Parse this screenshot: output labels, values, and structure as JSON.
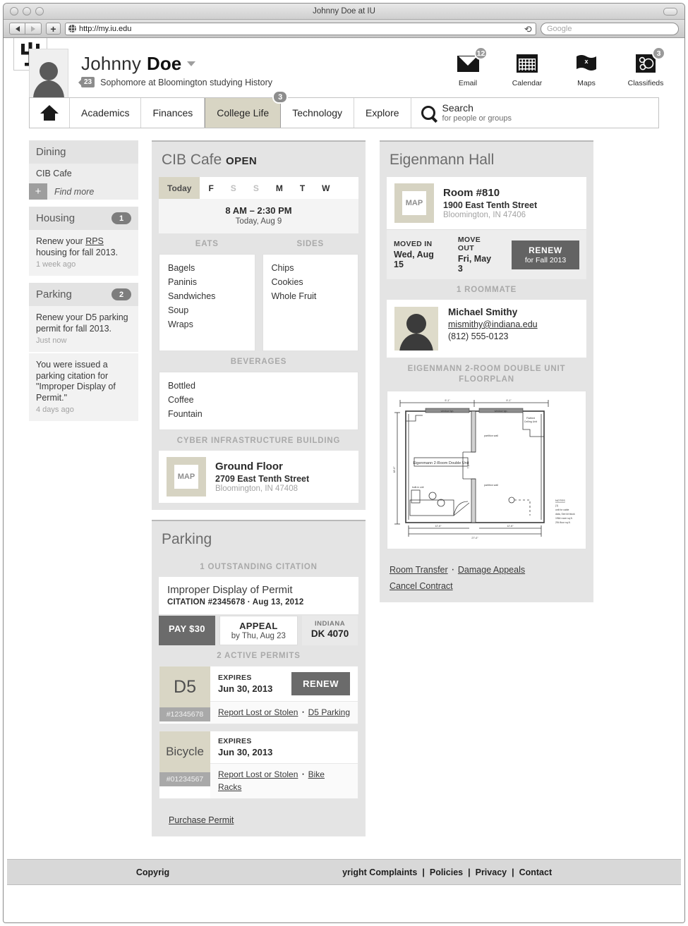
{
  "browser": {
    "window_title": "Johnny Doe at IU",
    "url": "http://my.iu.edu",
    "search_placeholder": "Google",
    "reload_icon": "reload-icon",
    "back_icon": "back-arrow-icon",
    "forward_icon": "forward-arrow-icon",
    "add_tab_icon": "plus-icon"
  },
  "header": {
    "logo": "iu-trident-logo",
    "avatar": "user-avatar",
    "first_name": "Johnny",
    "last_name": "Doe",
    "dropdown_icon": "chevron-down-icon",
    "notif_count": "23",
    "subtitle": "Sophomore at Bloomington studying History",
    "utilities": [
      {
        "label": "Email",
        "count": "12",
        "icon": "envelope-icon"
      },
      {
        "label": "Calendar",
        "count": "",
        "icon": "calendar-icon"
      },
      {
        "label": "Maps",
        "count": "",
        "icon": "map-flag-icon"
      },
      {
        "label": "Classifieds",
        "count": "3",
        "icon": "classifieds-icon"
      }
    ]
  },
  "nav": {
    "home_icon": "home-icon",
    "items": [
      {
        "label": "Academics",
        "badge": ""
      },
      {
        "label": "Finances",
        "badge": ""
      },
      {
        "label": "College Life",
        "badge": "3"
      },
      {
        "label": "Technology",
        "badge": ""
      },
      {
        "label": "Explore",
        "badge": ""
      }
    ],
    "search": {
      "icon": "search-icon",
      "title": "Search",
      "subtitle": "for people or groups"
    }
  },
  "sidebar": {
    "dining": {
      "title": "Dining",
      "badge": "",
      "items": [
        "CIB Cafe"
      ],
      "find_more": "Find more",
      "plus_icon": "plus-icon"
    },
    "housing": {
      "title": "Housing",
      "badge": "1",
      "notifications": [
        {
          "text_before": "Renew your ",
          "link": "RPS",
          "text_after": " housing for fall 2013.",
          "time": "1 week ago"
        }
      ]
    },
    "parking": {
      "title": "Parking",
      "badge": "2",
      "notifications": [
        {
          "text": "Renew your D5 parking permit for fall 2013.",
          "time": "Just now"
        },
        {
          "text": "You were issued a parking citation for \"Improper Display of Permit.\"",
          "time": "4 days ago"
        }
      ]
    }
  },
  "cafe": {
    "title": "CIB Cafe",
    "status": "OPEN",
    "days": [
      {
        "label": "Today",
        "selected": true,
        "dim": false
      },
      {
        "label": "F",
        "selected": false,
        "dim": false
      },
      {
        "label": "S",
        "selected": false,
        "dim": true
      },
      {
        "label": "S",
        "selected": false,
        "dim": true
      },
      {
        "label": "M",
        "selected": false,
        "dim": false
      },
      {
        "label": "T",
        "selected": false,
        "dim": false
      },
      {
        "label": "W",
        "selected": false,
        "dim": false
      }
    ],
    "hours": "8 AM – 2:30 PM",
    "hours_date": "Today, Aug 9",
    "menu": [
      {
        "heading": "EATS",
        "items": [
          "Bagels",
          "Paninis",
          "Sandwiches",
          "Soup",
          "Wraps"
        ]
      },
      {
        "heading": "SIDES",
        "items": [
          "Chips",
          "Cookies",
          "Whole Fruit"
        ]
      }
    ],
    "beverages": {
      "heading": "BEVERAGES",
      "items": [
        "Bottled",
        "Coffee",
        "Fountain"
      ]
    },
    "location": {
      "heading": "CYBER INFRASTRUCTURE BUILDING",
      "map_label": "MAP",
      "name": "Ground Floor",
      "street": "2709 East Tenth Street",
      "city": "Bloomington, IN 47408"
    }
  },
  "parking_panel": {
    "title": "Parking",
    "citation_heading": "1 OUTSTANDING CITATION",
    "citation": {
      "name": "Improper Display of Permit",
      "meta": "CITATION #2345678 · Aug 13, 2012",
      "pay_label": "PAY",
      "pay_amount": "$30",
      "appeal_label": "APPEAL",
      "appeal_due": "by Thu, Aug 23",
      "plate_state": "INDIANA",
      "plate_number": "DK 4070"
    },
    "permits_heading": "2 ACTIVE PERMITS",
    "permits": [
      {
        "tag": "D5",
        "number": "#12345678",
        "expires_label": "EXPIRES",
        "expires": "Jun 30, 2013",
        "renew_label": "RENEW",
        "links": [
          "Report Lost or Stolen",
          "D5 Parking"
        ]
      },
      {
        "tag": "Bicycle",
        "number": "#01234567",
        "expires_label": "EXPIRES",
        "expires": "Jun 30, 2013",
        "renew_label": "",
        "links": [
          "Report Lost or Stolen",
          "Bike Racks"
        ]
      }
    ],
    "purchase_link": "Purchase Permit"
  },
  "housing_panel": {
    "title": "Eigenmann Hall",
    "room": {
      "map_label": "MAP",
      "name": "Room #810",
      "street": "1900 East Tenth Street",
      "city": "Bloomington, IN 47406"
    },
    "moved_in_label": "MOVED IN",
    "moved_in": "Wed, Aug 15",
    "move_out_label": "MOVE OUT",
    "move_out": "Fri, May 3",
    "renew_label": "RENEW",
    "renew_sub": "for Fall 2013",
    "roommate_heading": "1 ROOMMATE",
    "roommate": {
      "avatar": "roommate-avatar",
      "name": "Michael Smithy",
      "email": "mismithy@indiana.edu",
      "phone": "(812) 555-0123"
    },
    "floorplan_heading": "EIGENMANN 2-ROOM DOUBLE UNIT FLOORPLAN",
    "floorplan_alt": "floorplan-drawing",
    "floorplan_room_label": "Eigenmann 2-Room Double Unit",
    "links": [
      "Room Transfer",
      "Damage Appeals",
      "Cancel Contract"
    ]
  },
  "footer": {
    "left_text": "Copyrig",
    "right_text": "yright Complaints",
    "links": [
      "Policies",
      "Privacy",
      "Contact"
    ],
    "separator": "|"
  },
  "colors": {
    "accent_khaki": "#d8d5c4",
    "badge_gray": "#8d8d8d",
    "panel_bg": "#e4e4e4",
    "button_dark": "#6b6b6b"
  }
}
